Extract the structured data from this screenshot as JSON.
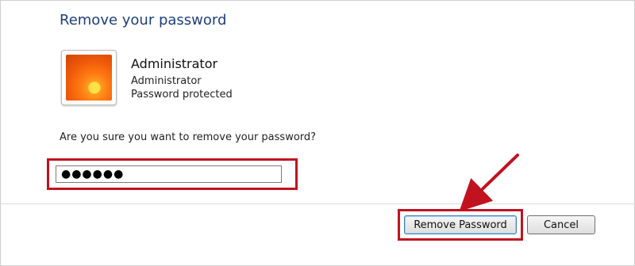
{
  "dialog": {
    "heading": "Remove your password",
    "user": {
      "name": "Administrator",
      "role": "Administrator",
      "status": "Password protected"
    },
    "question": "Are you sure you want to remove your password?",
    "password_field": {
      "value": "●●●●●●"
    },
    "buttons": {
      "remove_label": "Remove Password",
      "cancel_label": "Cancel"
    }
  },
  "colors": {
    "heading": "#1e3f7a",
    "highlight": "#c1121f"
  },
  "annotations": {
    "icon": "arrow-annotation-icon"
  }
}
